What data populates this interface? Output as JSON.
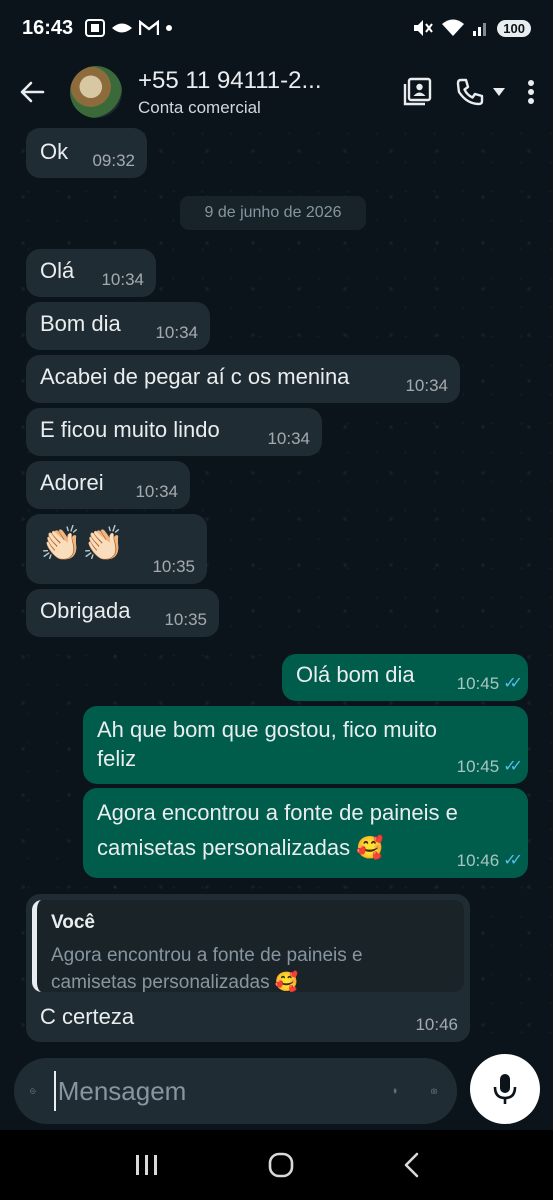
{
  "status_bar": {
    "time": "16:43",
    "battery": "100"
  },
  "header": {
    "contact_name": "+55 11 94111-2...",
    "contact_subtitle": "Conta comercial"
  },
  "date_separator": "9 de junho de 2026",
  "messages": [
    {
      "text": "Ok",
      "time": "09:32"
    },
    {
      "text": "Olá",
      "time": "10:34"
    },
    {
      "text": "Bom dia",
      "time": "10:34"
    },
    {
      "text": "Acabei de pegar aí c os menina",
      "time": "10:34"
    },
    {
      "text": "E ficou muito lindo",
      "time": "10:34"
    },
    {
      "text": "Adorei",
      "time": "10:34"
    },
    {
      "text": "👏🏻👏🏻",
      "time": "10:35"
    },
    {
      "text": "Obrigada",
      "time": "10:35"
    },
    {
      "text": "Olá bom dia",
      "time": "10:45",
      "read_ticks": "✓✓"
    },
    {
      "text_line1": "Ah que bom que gostou, fico muito",
      "text_line2": "feliz",
      "time": "10:45",
      "read_ticks": "✓✓"
    },
    {
      "text_line1": "Agora encontrou a fonte de paineis e",
      "text_line2": "camisetas personalizadas 🥰",
      "time": "10:46",
      "read_ticks": "✓✓"
    },
    {
      "quote_author": "Você",
      "quote_line1": "Agora encontrou a fonte de paineis e",
      "quote_line2": "camisetas personalizadas 🥰",
      "text": "C certeza",
      "time": "10:46"
    }
  ],
  "input": {
    "placeholder": "Mensagem"
  },
  "colors": {
    "background": "#0b141a",
    "incoming_bubble": "#202c33",
    "outgoing_bubble": "#005c4b",
    "read_tick": "#53bdeb"
  },
  "icons": [
    "back-arrow-icon",
    "contact-card-icon",
    "phone-icon",
    "caret-down-icon",
    "more-vert-icon",
    "sticker-icon",
    "attach-icon",
    "camera-icon",
    "mic-icon",
    "recents-icon",
    "home-icon",
    "nav-back-icon"
  ]
}
